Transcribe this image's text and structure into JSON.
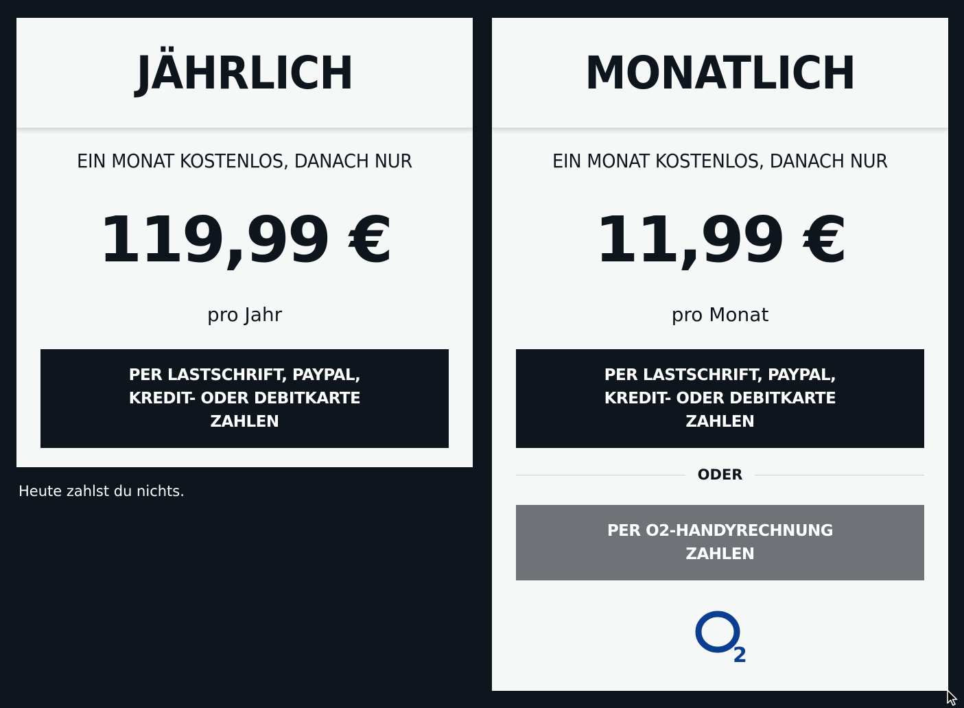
{
  "plans": {
    "yearly": {
      "title": "JÄHRLICH",
      "intro": "EIN MONAT KOSTENLOS, DANACH NUR",
      "price": "119,99 €",
      "period": "pro Jahr",
      "pay_button": "PER LASTSCHRIFT, PAYPAL,\nKREDIT- ODER DEBITKARTE\nZAHLEN"
    },
    "monthly": {
      "title": "MONATLICH",
      "intro": "EIN MONAT KOSTENLOS, DANACH NUR",
      "price": "11,99 €",
      "period": "pro Monat",
      "pay_button": "PER LASTSCHRIFT, PAYPAL,\nKREDIT- ODER DEBITKARTE\nZAHLEN",
      "divider_label": "ODER",
      "o2_button": "PER O2-HANDYRECHNUNG\nZAHLEN",
      "o2_logo": "O2"
    }
  },
  "note": "Heute zahlst du nichts.",
  "colors": {
    "background": "#0e151d",
    "card": "#f6f8f8",
    "primary_button": "#0e151d",
    "secondary_button": "#6f7377",
    "o2_brand": "#0b3d91"
  },
  "icons": {
    "cursor": "mouse-pointer-icon"
  }
}
